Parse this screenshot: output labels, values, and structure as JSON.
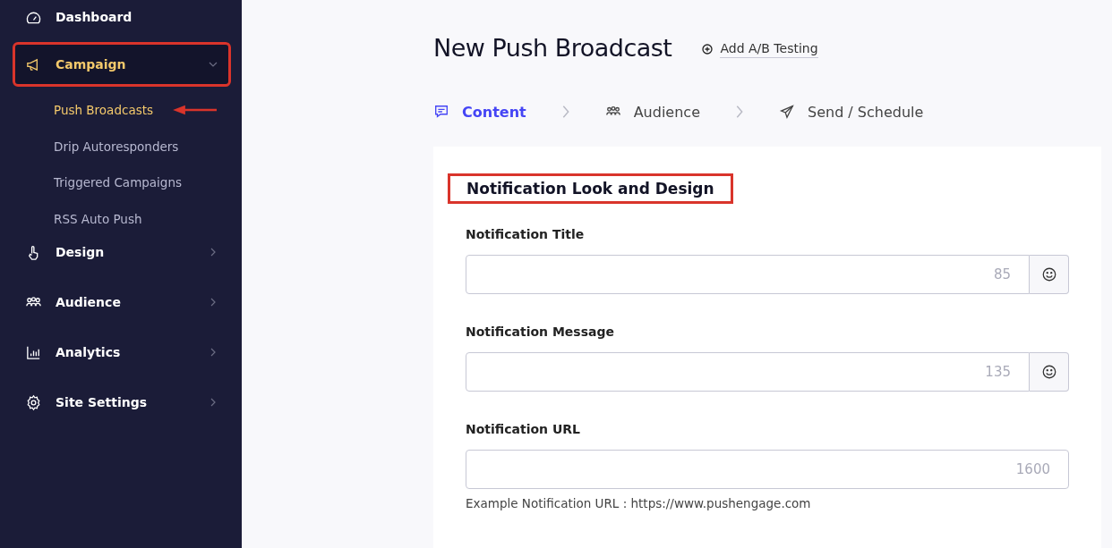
{
  "sidebar": {
    "items": [
      {
        "label": "Dashboard",
        "has_chevron": false,
        "selected": false,
        "annotated": false
      },
      {
        "label": "Campaign",
        "expanded": true,
        "has_chevron": true,
        "selected": true,
        "annotated": true,
        "children": [
          {
            "label": "Push Broadcasts",
            "selected": true,
            "arrow": true
          },
          {
            "label": "Drip Autoresponders",
            "selected": false,
            "arrow": false
          },
          {
            "label": "Triggered Campaigns",
            "selected": false,
            "arrow": false
          },
          {
            "label": "RSS Auto Push",
            "selected": false,
            "arrow": false
          }
        ]
      },
      {
        "label": "Design",
        "expanded": false,
        "has_chevron": true,
        "selected": false,
        "annotated": false
      },
      {
        "label": "Audience",
        "expanded": false,
        "has_chevron": true,
        "selected": false,
        "annotated": false
      },
      {
        "label": "Analytics",
        "expanded": false,
        "has_chevron": true,
        "selected": false,
        "annotated": false
      },
      {
        "label": "Site Settings",
        "expanded": false,
        "has_chevron": true,
        "selected": false,
        "annotated": false
      }
    ]
  },
  "page": {
    "title": "New Push Broadcast",
    "ab_link": "Add A/B Testing"
  },
  "steps": [
    {
      "label": "Content",
      "selected": true
    },
    {
      "label": "Audience",
      "selected": false
    },
    {
      "label": "Send / Schedule",
      "selected": false
    }
  ],
  "section": {
    "heading": "Notification Look and Design",
    "annotated": true,
    "fields": [
      {
        "label": "Notification Title",
        "counter": "85",
        "emoji": true
      },
      {
        "label": "Notification Message",
        "counter": "135",
        "emoji": true
      },
      {
        "label": "Notification URL",
        "counter": "1600",
        "emoji": false,
        "hint": "Example Notification URL : https://www.pushengage.com"
      }
    ]
  }
}
